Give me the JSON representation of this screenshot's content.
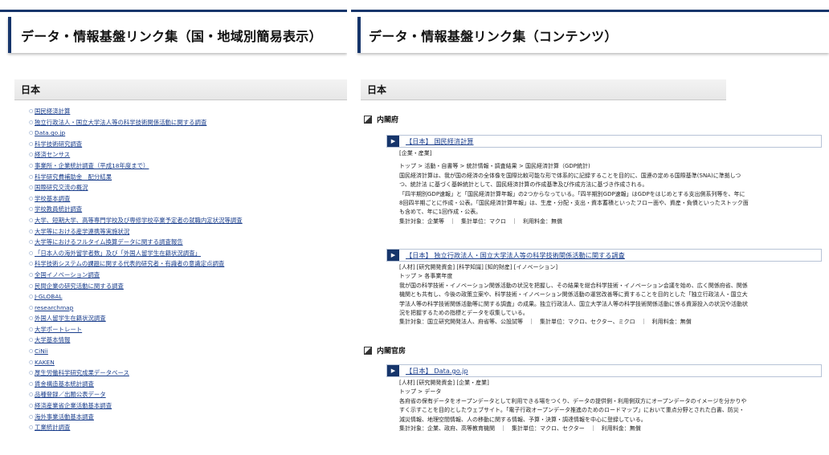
{
  "left": {
    "title": "データ・情報基盤リンク集（国・地域別簡易表示）",
    "section": "日本",
    "items": [
      "国民経済計算",
      "独立行政法人・国立大学法人等の科学技術関係活動に関する調査",
      "Data.go.jp",
      "科学技術研究調査",
      "経済センサス",
      "事業所・企業統計調査（平成18年度まで）",
      "科学研究費補助金　配分結果",
      "国際研究交流の概況",
      "学校基本調査",
      "学校教員統計調査",
      "大学、短期大学、高等専門学校及び専修学校卒業予定者の就職内定状況等調査",
      "大学等における産学連携等実施状況",
      "大学等におけるフルタイム換算データに関する調査報告",
      "「日本人の海外留学者数」及び「外国人留学生在籍状況調査」",
      "科学技術システムの課題に関する代表的研究者・有識者の意識定点調査",
      "全国イノベーション調査",
      "民間企業の研究活動に関する調査",
      "J-GLOBAL",
      "researchmap",
      "外国人留学生在籍状況調査",
      "大学ポートレート",
      "大学基本情報",
      "CiNii",
      "KAKEN",
      "厚生労働科学研究成果データベース",
      "賃金構造基本統計調査",
      "品種登録／出願公表データ",
      "経済産業省企業活動基本調査",
      "海外事業活動基本調査",
      "工業統計調査"
    ]
  },
  "right": {
    "title": "データ・情報基盤リンク集（コンテンツ）",
    "section": "日本",
    "orgs": [
      {
        "name": "内閣府",
        "entries": [
          {
            "title": "【日本】 国民経済計算",
            "tags": "[企業・産業]",
            "path": "トップ > 活動・自書等 > 統計情報・調査結果 > 国民経済計算（GDP統計)",
            "desc": [
              "国民経済計算は、我が国の経済の全体像を国際比較可能な形で体系的に記録することを目的に、国連の定める国際基準(SNA)に準拠しつ",
              "つ、統計法 に基づく基幹統計として、国民経済計算の作成基準及び作成方法に基づき作成される。",
              "「四半期別GDP速報」と「国民経済計算年報」の2つからなっている。「四半期別GDP速報」はGDPをはじめとする支出側系列等を、年に",
              "8回四半期ごとに作成・公表。「国民経済計算年報」は、生産・分配・支出・資本蓄積といったフロー面や、資産・負債といったストック面",
              "も含めて、年に1回作成・公表。"
            ],
            "meta": "集計対象：企業等　｜　集計単位：マクロ　｜　利用料金：無償"
          },
          {
            "title": "【日本】 独立行政法人・国立大学法人等の科学技術関係活動に関する調査",
            "tags": "[人材] [研究開発資金] [科学知識] [知的財産] [イノベーション]",
            "path": "トップ > 各事業年度",
            "desc": [
              "我が国の科学技術・イノベーション関係活動の状況を把握し、その結果を総合科学技術・イノベーション会議を始め、広く関係府省、関係",
              "機関とも共有し、今後の政策立案や、科学技術・イノベーション関係活動の運営改善等に資することを目的とした「独立行政法人・国立大",
              "学法人等の科学技術関係活動等に関する調査」の成果。独立行政法人、国立大学法人等の科学技術関係活動に係る資源投入の状況や活動状",
              "況を把握するための指標とデータを収集している。"
            ],
            "meta": "集計対象：国立研究開発法人、府省等、公設試等　｜　集計単位：マクロ、セクター、ミクロ　｜　利用料金：無償"
          }
        ]
      },
      {
        "name": "内閣官房",
        "entries": [
          {
            "title": "【日本】 Data.go.jp",
            "tags": "[人材] [研究開発資金] [企業・産業]",
            "path": "トップ > データ",
            "desc": [
              "各府省の保有データをオープンデータとして利用できる場をつくり、データの提供側・利用側双方にオープンデータのイメージを分かりや",
              "すく示すことを目的としたウェブサイト。「電子行政オープンデータ推進のためのロードマップ」において重点分野とされた白書、防災・",
              "減災情報、地理空間情報、人の移動に関する情報、予算・決算・調達情報を中心に登録している。"
            ],
            "meta": "集計対象：企業、政府、高等教育機関　｜　集計単位：マクロ、セクター　｜　利用料金：無償"
          }
        ]
      }
    ]
  }
}
